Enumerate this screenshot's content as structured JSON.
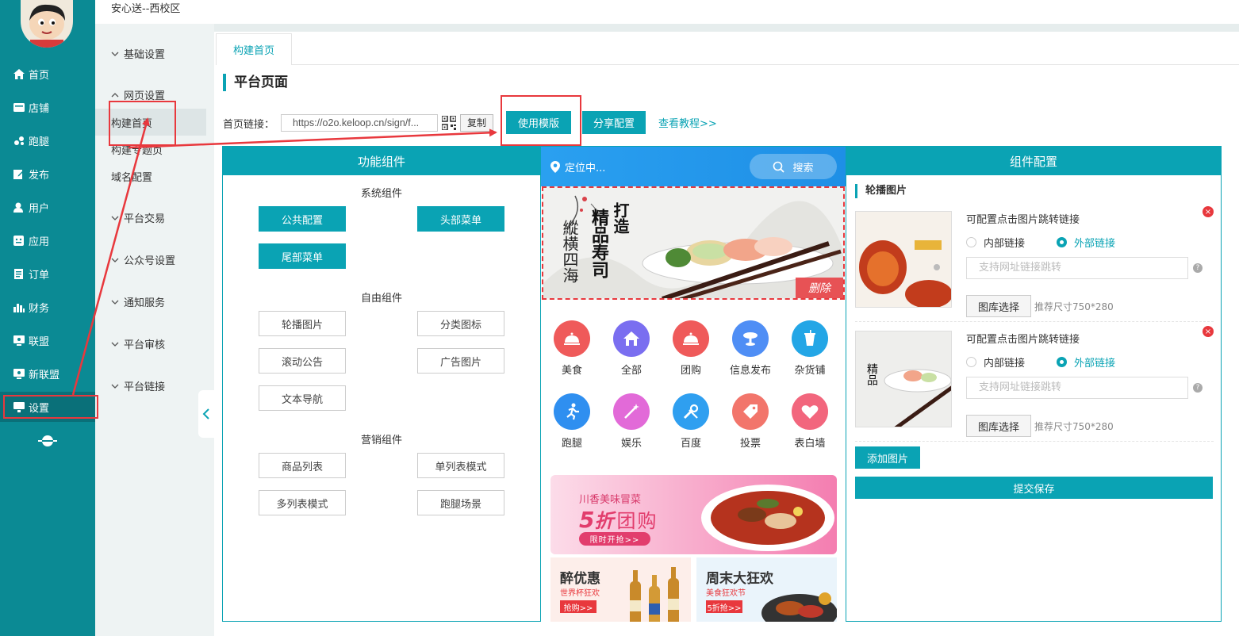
{
  "header": {
    "site_title": "安心送--西校区"
  },
  "nav": {
    "items": [
      {
        "label": "首页",
        "icon": "home-icon"
      },
      {
        "label": "店铺",
        "icon": "store-icon"
      },
      {
        "label": "跑腿",
        "icon": "errand-icon"
      },
      {
        "label": "发布",
        "icon": "edit-icon"
      },
      {
        "label": "用户",
        "icon": "user-icon"
      },
      {
        "label": "应用",
        "icon": "app-icon"
      },
      {
        "label": "订单",
        "icon": "order-icon"
      },
      {
        "label": "财务",
        "icon": "finance-icon"
      },
      {
        "label": "联盟",
        "icon": "alliance-icon"
      },
      {
        "label": "新联盟",
        "icon": "new-alliance-icon"
      },
      {
        "label": "设置",
        "icon": "settings-icon"
      }
    ]
  },
  "subnav": {
    "groups": [
      {
        "label": "基础设置"
      },
      {
        "label": "网页设置"
      },
      {
        "label": "平台交易"
      },
      {
        "label": "公众号设置"
      },
      {
        "label": "通知服务"
      },
      {
        "label": "平台审核"
      },
      {
        "label": "平台链接"
      }
    ],
    "links": [
      {
        "label": "构建首页"
      },
      {
        "label": "构建专题页"
      },
      {
        "label": "域名配置"
      }
    ]
  },
  "tab": {
    "label": "构建首页"
  },
  "page": {
    "title": "平台页面",
    "url_label": "首页链接：",
    "url_value": "https://o2o.keloop.cn/sign/f...",
    "copy_label": "复制",
    "use_template_label": "使用模版",
    "share_config_label": "分享配置",
    "tutorial_label": "查看教程>>"
  },
  "components": {
    "title": "功能组件",
    "system_title": "系统组件",
    "system": [
      "公共配置",
      "头部菜单",
      "尾部菜单"
    ],
    "free_title": "自由组件",
    "free": [
      "轮播图片",
      "分类图标",
      "滚动公告",
      "广告图片",
      "文本导航"
    ],
    "marketing_title": "营销组件",
    "marketing": [
      "商品列表",
      "单列表模式",
      "多列表模式",
      "跑腿场景"
    ]
  },
  "phone": {
    "location": "定位中...",
    "search": "搜索",
    "banner_title_1": "打造",
    "banner_title_2": "精品寿司",
    "banner_title_3": "縱横四海",
    "banner_delete": "删除",
    "categories": [
      {
        "label": "美食",
        "color": "#ef5a5a"
      },
      {
        "label": "全部",
        "color": "#7a6ef0"
      },
      {
        "label": "团购",
        "color": "#ef5a5a"
      },
      {
        "label": "信息发布",
        "color": "#4f8ef5"
      },
      {
        "label": "杂货铺",
        "color": "#23a6e6"
      },
      {
        "label": "跑腿",
        "color": "#2f8ff0"
      },
      {
        "label": "娱乐",
        "color": "#e26ad8"
      },
      {
        "label": "百度",
        "color": "#2f9ff0"
      },
      {
        "label": "投票",
        "color": "#f2756b"
      },
      {
        "label": "表白墙",
        "color": "#f2667d"
      }
    ],
    "promo": {
      "sub": "川香美味冒菜",
      "main_num": "5",
      "main_zhe": "折",
      "main_rest": "团购",
      "cta": "限时开抢>>"
    },
    "promo_left": {
      "title": "醉优惠",
      "sub": "世界杯狂欢",
      "cta": "抢购>>"
    },
    "promo_right": {
      "title": "周末大狂欢",
      "sub": "美食狂欢节",
      "cta": "5折抢>>"
    }
  },
  "config": {
    "title": "组件配置",
    "section_title": "轮播图片",
    "rows": [
      {
        "label": "可配置点击图片跳转链接",
        "internal": "内部链接",
        "external": "外部链接",
        "placeholder": "支持网址链接跳转",
        "gallery": "图库选择",
        "size_hint": "推荐尺寸750*280"
      },
      {
        "label": "可配置点击图片跳转链接",
        "internal": "内部链接",
        "external": "外部链接",
        "placeholder": "支持网址链接跳转",
        "gallery": "图库选择",
        "size_hint": "推荐尺寸750*280"
      }
    ],
    "add_label": "添加图片",
    "submit_label": "提交保存"
  },
  "colors": {
    "accent": "#0aa3b4",
    "sidebar": "#0b8a94",
    "highlight": "#e8383d"
  }
}
